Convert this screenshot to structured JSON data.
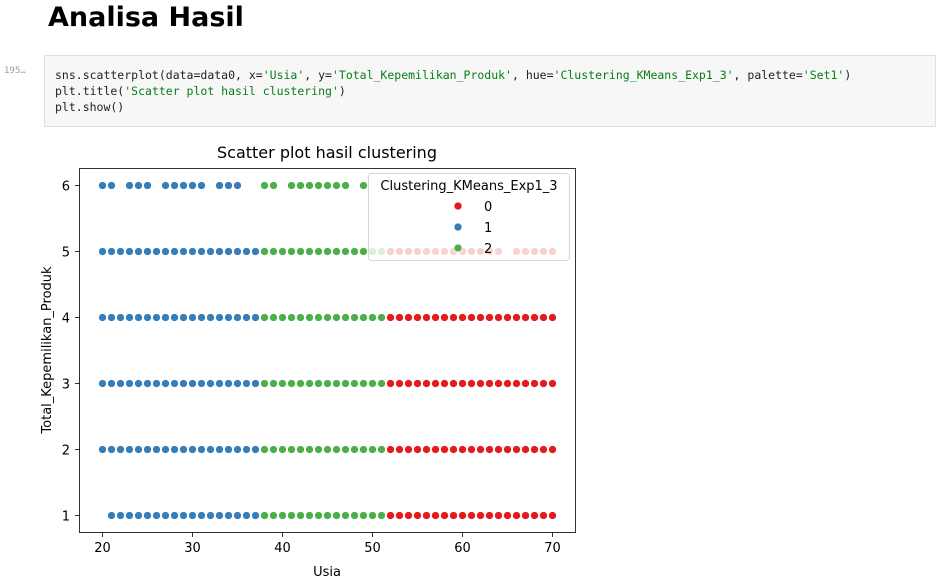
{
  "heading": "Analisa Hasil",
  "cell": {
    "prompt": "195…",
    "code": [
      [
        {
          "t": "sns.scatterplot(data=data0, x=",
          "s": false
        },
        {
          "t": "'Usia'",
          "s": true
        },
        {
          "t": ", y=",
          "s": false
        },
        {
          "t": "'Total_Kepemilikan_Produk'",
          "s": true
        },
        {
          "t": ", hue=",
          "s": false
        },
        {
          "t": "'Clustering_KMeans_Exp1_3'",
          "s": true
        },
        {
          "t": ", palette=",
          "s": false
        },
        {
          "t": "'Set1'",
          "s": true
        },
        {
          "t": ")",
          "s": false
        }
      ],
      [
        {
          "t": "plt.title(",
          "s": false
        },
        {
          "t": "'Scatter plot hasil clustering'",
          "s": true
        },
        {
          "t": ")",
          "s": false
        }
      ],
      [
        {
          "t": "plt.show()",
          "s": false
        }
      ]
    ]
  },
  "chart_data": {
    "type": "scatter",
    "title": "Scatter plot hasil clustering",
    "xlabel": "Usia",
    "ylabel": "Total_Kepemilikan_Produk",
    "xlim": [
      17.5,
      72.5
    ],
    "ylim": [
      0.75,
      6.25
    ],
    "xticks": [
      20,
      30,
      40,
      50,
      60,
      70
    ],
    "yticks": [
      1,
      2,
      3,
      4,
      5,
      6
    ],
    "grid": false,
    "legend": {
      "title": "Clustering_KMeans_Exp1_3",
      "placement": "top-right"
    },
    "series": [
      {
        "name": "0",
        "color": "#e41a1c",
        "points": [
          {
            "y": 1,
            "x": [
              52,
              53,
              54,
              55,
              56,
              57,
              58,
              59,
              60,
              61,
              62,
              63,
              64,
              65,
              66,
              67,
              68,
              69,
              70
            ]
          },
          {
            "y": 2,
            "x": [
              52,
              53,
              54,
              55,
              56,
              57,
              58,
              59,
              60,
              61,
              62,
              63,
              64,
              65,
              66,
              67,
              68,
              69,
              70
            ]
          },
          {
            "y": 3,
            "x": [
              52,
              53,
              54,
              55,
              56,
              57,
              58,
              59,
              60,
              61,
              62,
              63,
              64,
              65,
              66,
              67,
              68,
              69,
              70
            ]
          },
          {
            "y": 4,
            "x": [
              52,
              53,
              54,
              55,
              56,
              57,
              58,
              59,
              60,
              61,
              62,
              63,
              64,
              65,
              66,
              67,
              68,
              69,
              70
            ]
          },
          {
            "y": 5,
            "x": [
              52,
              53,
              54,
              55,
              56,
              57,
              58,
              59,
              60,
              61,
              62,
              63,
              64,
              66,
              67,
              68,
              69,
              70
            ]
          }
        ]
      },
      {
        "name": "1",
        "color": "#377eb8",
        "points": [
          {
            "y": 1,
            "x": [
              21,
              22,
              23,
              24,
              25,
              26,
              27,
              28,
              29,
              30,
              31,
              32,
              33,
              34,
              35,
              36,
              37
            ]
          },
          {
            "y": 2,
            "x": [
              20,
              21,
              22,
              23,
              24,
              25,
              26,
              27,
              28,
              29,
              30,
              31,
              32,
              33,
              34,
              35,
              36,
              37
            ]
          },
          {
            "y": 3,
            "x": [
              20,
              21,
              22,
              23,
              24,
              25,
              26,
              27,
              28,
              29,
              30,
              31,
              32,
              33,
              34,
              35,
              36,
              37
            ]
          },
          {
            "y": 4,
            "x": [
              20,
              21,
              22,
              23,
              24,
              25,
              26,
              27,
              28,
              29,
              30,
              31,
              32,
              33,
              34,
              35,
              36,
              37
            ]
          },
          {
            "y": 5,
            "x": [
              20,
              21,
              22,
              23,
              24,
              25,
              26,
              27,
              28,
              29,
              30,
              31,
              32,
              33,
              34,
              35,
              36,
              37
            ]
          },
          {
            "y": 6,
            "x": [
              20,
              21,
              23,
              24,
              25,
              27,
              28,
              29,
              30,
              31,
              33,
              34,
              35
            ]
          }
        ]
      },
      {
        "name": "2",
        "color": "#4daf4a",
        "points": [
          {
            "y": 1,
            "x": [
              38,
              39,
              40,
              41,
              42,
              43,
              44,
              45,
              46,
              47,
              48,
              49,
              50,
              51
            ]
          },
          {
            "y": 2,
            "x": [
              38,
              39,
              40,
              41,
              42,
              43,
              44,
              45,
              46,
              47,
              48,
              49,
              50,
              51
            ]
          },
          {
            "y": 3,
            "x": [
              38,
              39,
              40,
              41,
              42,
              43,
              44,
              45,
              46,
              47,
              48,
              49,
              50,
              51
            ]
          },
          {
            "y": 4,
            "x": [
              38,
              39,
              40,
              41,
              42,
              43,
              44,
              45,
              46,
              47,
              48,
              49,
              50,
              51
            ]
          },
          {
            "y": 5,
            "x": [
              38,
              39,
              40,
              41,
              42,
              43,
              44,
              45,
              46,
              47,
              48,
              49,
              50,
              51
            ]
          },
          {
            "y": 6,
            "x": [
              38,
              39,
              41,
              42,
              43,
              44,
              45,
              46,
              47,
              49
            ]
          }
        ]
      }
    ]
  }
}
